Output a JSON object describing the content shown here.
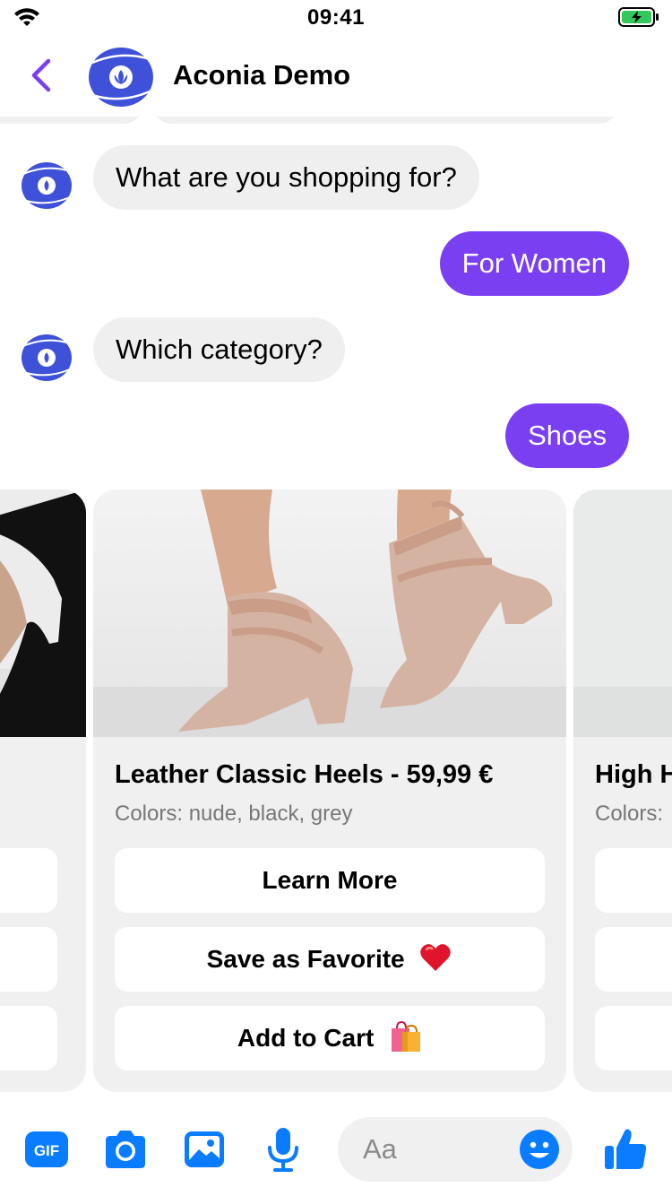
{
  "status_bar": {
    "time": "09:41"
  },
  "header": {
    "title": "Aconia Demo"
  },
  "messages": [
    {
      "from": "bot",
      "text": "What are you shopping for?"
    },
    {
      "from": "user",
      "text": "For Women"
    },
    {
      "from": "bot",
      "text": "Which category?"
    },
    {
      "from": "user",
      "text": "Shoes"
    }
  ],
  "products": [
    {
      "title": "Leather Classic Heels - 59,99 €",
      "subtitle": "Colors: nude, black, grey",
      "buttons": [
        "Learn More",
        "Save as Favorite",
        "Add to Cart"
      ]
    },
    {
      "title": "High H",
      "subtitle": "Colors:"
    }
  ],
  "composer": {
    "placeholder": "Aa"
  },
  "colors": {
    "accent": "#7b3ff2",
    "messenger_blue": "#0a7cff",
    "bot_avatar": "#3f51d8"
  },
  "icons": [
    "wifi-icon",
    "battery-icon",
    "back-chevron-icon",
    "bot-avatar-icon",
    "gif-icon",
    "camera-icon",
    "image-icon",
    "mic-icon",
    "emoji-icon",
    "thumbs-up-icon",
    "heart-emoji-icon",
    "shopping-bags-emoji-icon"
  ]
}
